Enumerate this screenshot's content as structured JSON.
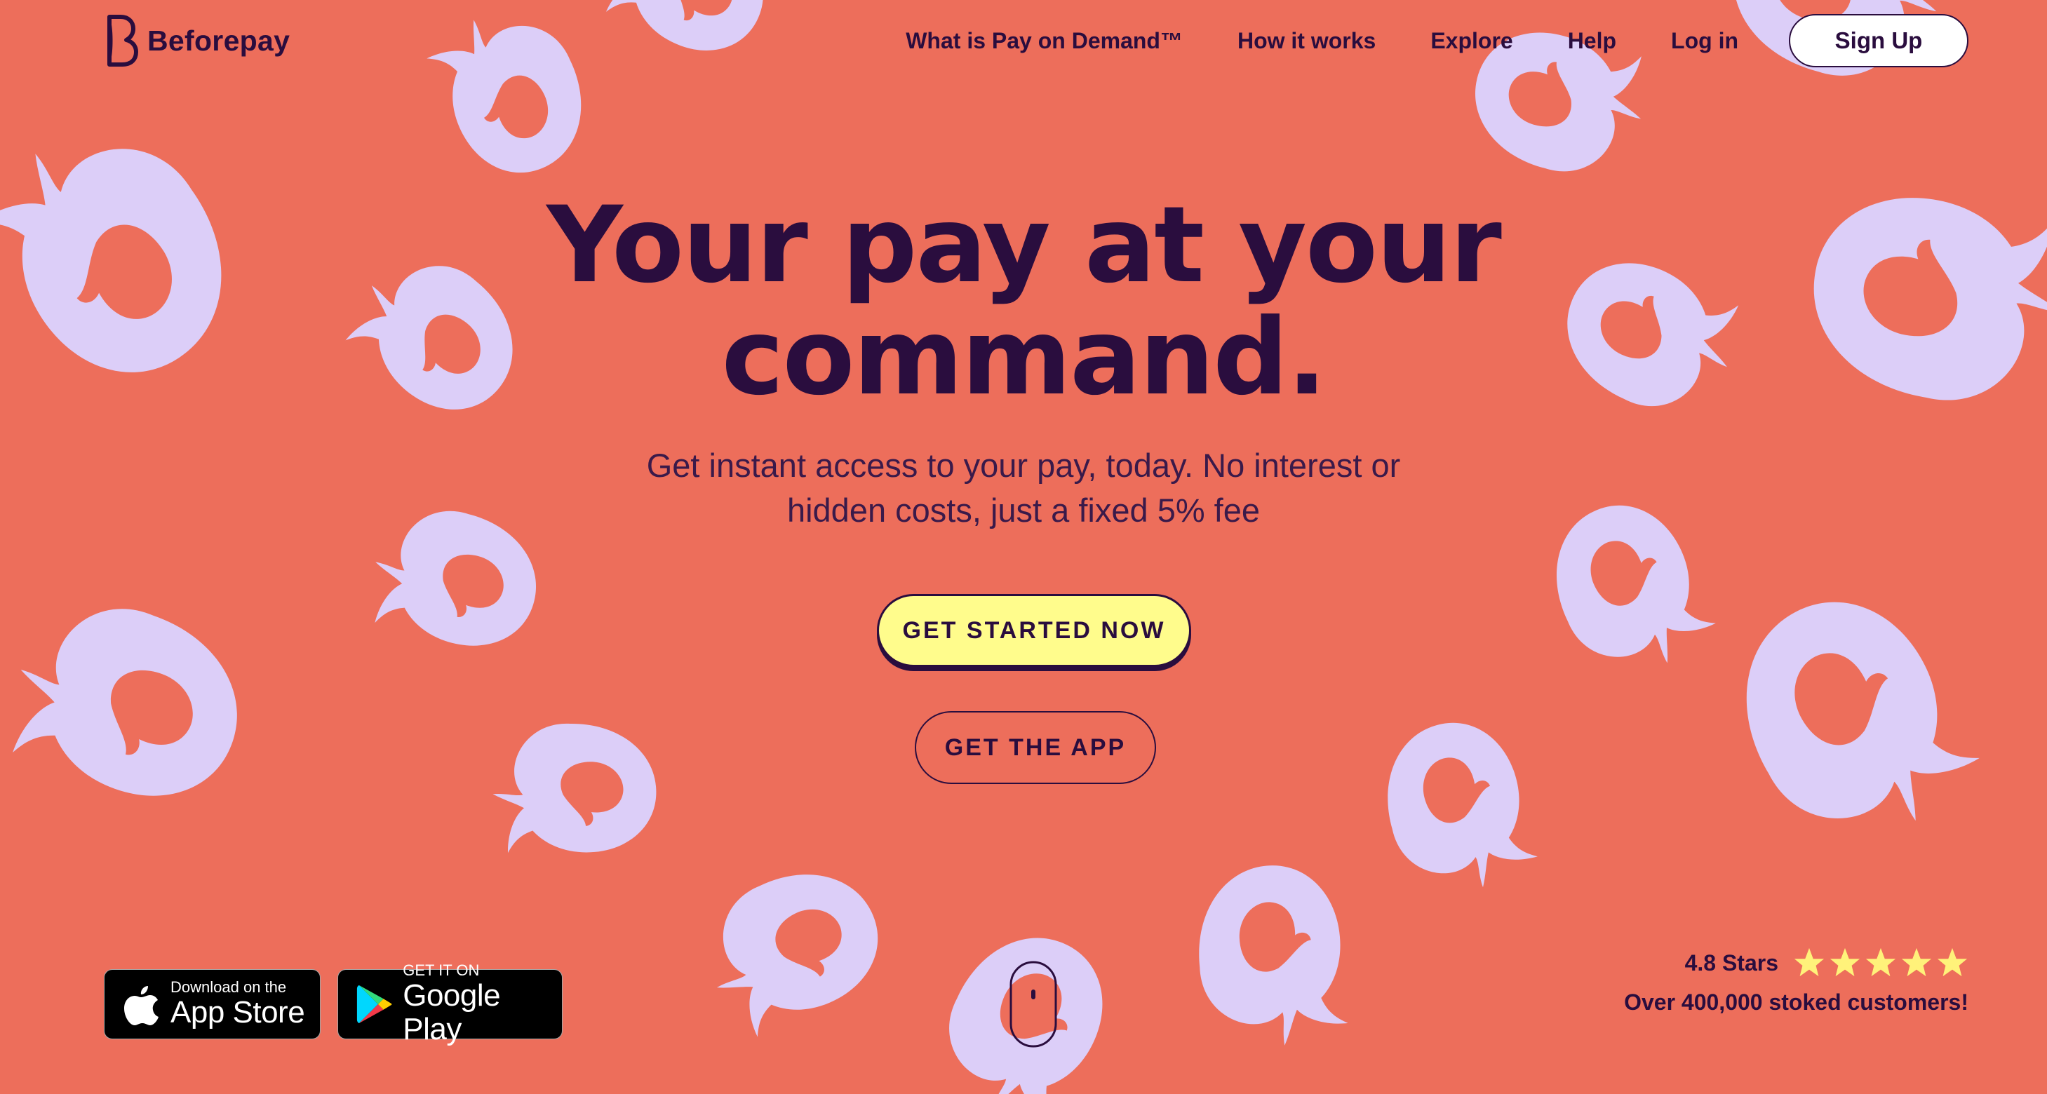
{
  "brand": {
    "name": "Beforepay",
    "logo_icon": "b-logo-icon"
  },
  "nav": {
    "links": [
      "What is Pay on Demand™",
      "How it works",
      "Explore",
      "Help",
      "Log in"
    ],
    "signup_label": "Sign Up"
  },
  "hero": {
    "title_line1": "Your pay at your",
    "title_line2": "command.",
    "subtitle_line1": "Get instant access to your pay, today. No interest or",
    "subtitle_line2": "hidden costs, just a fixed 5% fee",
    "primary_cta": "GET STARTED NOW",
    "secondary_cta": "GET THE APP"
  },
  "app_store": {
    "small": "Download on the",
    "big": "App Store",
    "icon": "apple-icon"
  },
  "google_play": {
    "small": "GET IT ON",
    "big": "Google Play",
    "icon": "google-play-icon"
  },
  "rating": {
    "label": "4.8 Stars",
    "stars": 5,
    "customers": "Over 400,000 stoked customers!"
  },
  "colors": {
    "background": "#ED6E5B",
    "shapes": "#DCCEF8",
    "text": "#2A0D3E",
    "cta_yellow": "#FFFC8C",
    "star": "#FFF27A"
  }
}
